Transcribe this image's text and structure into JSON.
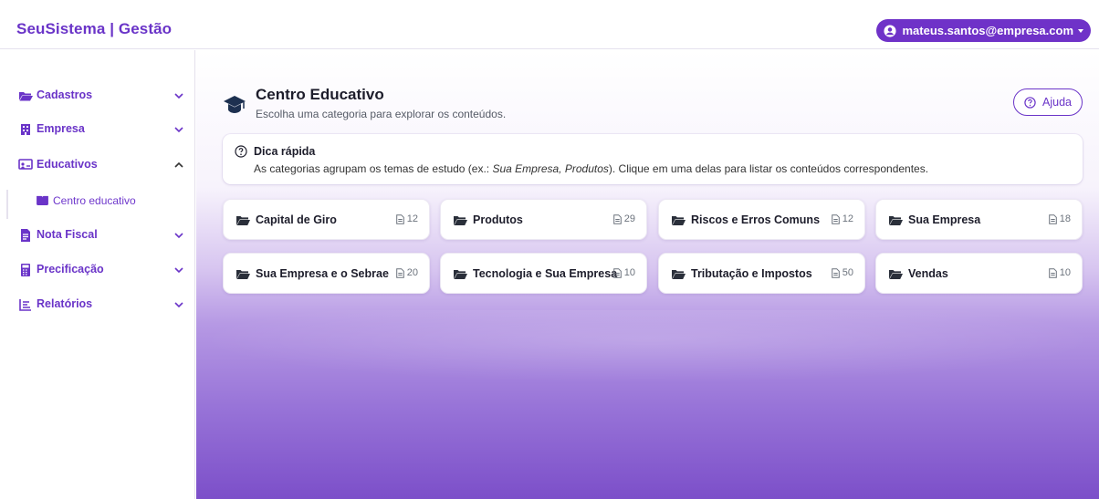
{
  "brand": "SeuSistema | Gestão",
  "user": {
    "email": "mateus.santos@empresa.com"
  },
  "sidebar": {
    "items": [
      {
        "label": "Cadastros",
        "icon": "folder-open-icon",
        "expanded": false
      },
      {
        "label": "Empresa",
        "icon": "building-icon",
        "expanded": false
      },
      {
        "label": "Educativos",
        "icon": "chalkboard-icon",
        "expanded": true
      },
      {
        "label": "Nota Fiscal",
        "icon": "invoice-icon",
        "expanded": false
      },
      {
        "label": "Precificação",
        "icon": "calculator-icon",
        "expanded": false
      },
      {
        "label": "Relatórios",
        "icon": "chart-icon",
        "expanded": false
      }
    ],
    "subitems": [
      {
        "label": "Centro educativo",
        "icon": "book-open-icon"
      }
    ]
  },
  "header": {
    "title": "Centro Educativo",
    "subtitle": "Escolha uma categoria para explorar os conteúdos.",
    "help_label": "Ajuda"
  },
  "tip": {
    "title": "Dica rápida",
    "text_before": "As categorias agrupam os temas de estudo (ex.: ",
    "example": "Sua Empresa, Produtos",
    "text_after": "). Clique em uma delas para listar os conteúdos correspondentes."
  },
  "categories": [
    {
      "name": "Capital de Giro",
      "count": "12"
    },
    {
      "name": "Produtos",
      "count": "29"
    },
    {
      "name": "Riscos e Erros Comuns",
      "count": "12"
    },
    {
      "name": "Sua Empresa",
      "count": "18"
    },
    {
      "name": "Sua Empresa e o Sebrae",
      "count": "20"
    },
    {
      "name": "Tecnologia e Sua Empresa",
      "count": "10"
    },
    {
      "name": "Tributação e Impostos",
      "count": "50"
    },
    {
      "name": "Vendas",
      "count": "10"
    }
  ],
  "colors": {
    "accent": "#6a34c8",
    "user_pill": "#6f32c8",
    "gradient_bottom": "#7c4fc9"
  }
}
